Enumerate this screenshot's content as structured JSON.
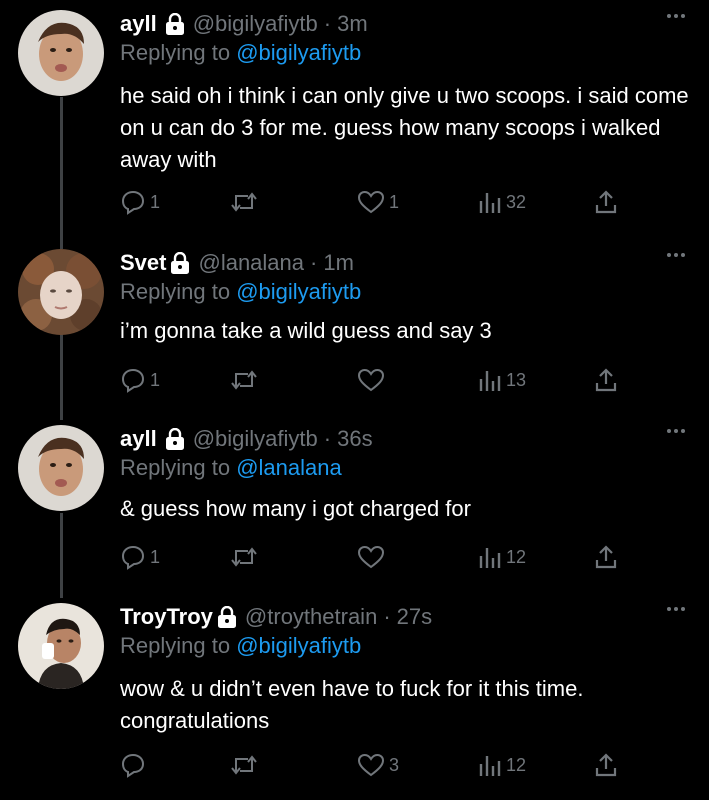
{
  "tweets": [
    {
      "name": "ayll",
      "handle": "@bigilyafiytb",
      "time": "3m",
      "reply_prefix": "Replying to",
      "reply_to": "@bigilyafiytb",
      "text": "he said oh i think i can only give u two scoops. i said come on u can do 3 for me. guess how many scoops i walked away with",
      "replies": "1",
      "retweets": "",
      "likes": "1",
      "views": "32"
    },
    {
      "name": "Svet",
      "handle": "@lanalana",
      "time": "1m",
      "reply_prefix": "Replying to",
      "reply_to": "@bigilyafiytb",
      "text": "i’m gonna take a wild guess and say 3",
      "replies": "1",
      "retweets": "",
      "likes": "",
      "views": "13"
    },
    {
      "name": "ayll",
      "handle": "@bigilyafiytb",
      "time": "36s",
      "reply_prefix": "Replying to",
      "reply_to": "@lanalana",
      "text": "& guess how many i got charged for",
      "replies": "1",
      "retweets": "",
      "likes": "",
      "views": "12"
    },
    {
      "name": "TroyTroy",
      "handle": "@troythetrain",
      "time": "27s",
      "reply_prefix": "Replying to",
      "reply_to": "@bigilyafiytb",
      "text": "wow & u didn’t even have to fuck for it this time. congratulations",
      "replies": "",
      "retweets": "",
      "likes": "3",
      "views": "12"
    }
  ],
  "separator": "·",
  "icons": {
    "lock": "lock-icon",
    "more": "more-icon",
    "reply": "reply-icon",
    "retweet": "retweet-icon",
    "like": "heart-icon",
    "views": "views-icon",
    "share": "share-icon"
  },
  "colors": {
    "background": "#000000",
    "text": "#ffffff",
    "muted": "#71767b",
    "link": "#1d9bf0",
    "thread_line": "#3e4144"
  }
}
